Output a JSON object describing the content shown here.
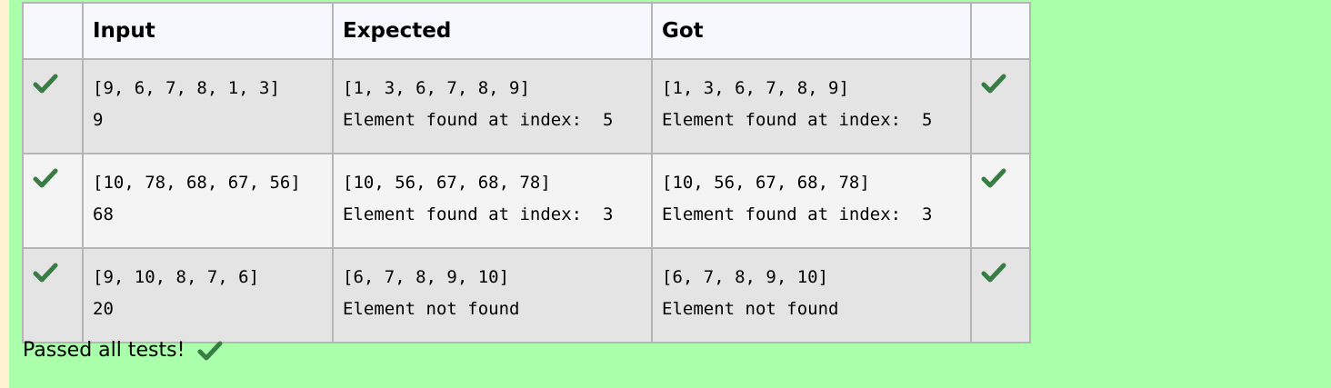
{
  "colors": {
    "page_background": "#aaffaa",
    "left_strip": "#fdf3d2",
    "check_mark": "#3a7d44",
    "header_background": "#f6f8fd",
    "row_odd_background": "#e4e4e4",
    "row_even_background": "#f4f4f4"
  },
  "table": {
    "headers": [
      "",
      "Input",
      "Expected",
      "Got",
      ""
    ],
    "rows": [
      {
        "status_icon": "check-icon",
        "input": [
          "[9, 6, 7, 8, 1, 3]",
          "9"
        ],
        "expected": [
          "[1, 3, 6, 7, 8, 9]",
          "Element found at index:  5"
        ],
        "got": [
          "[1, 3, 6, 7, 8, 9]",
          "Element found at index:  5"
        ],
        "result_icon": "check-icon"
      },
      {
        "status_icon": "check-icon",
        "input": [
          "[10, 78, 68, 67, 56]",
          "68"
        ],
        "expected": [
          "[10, 56, 67, 68, 78]",
          "Element found at index:  3"
        ],
        "got": [
          "[10, 56, 67, 68, 78]",
          "Element found at index:  3"
        ],
        "result_icon": "check-icon"
      },
      {
        "status_icon": "check-icon",
        "input": [
          "[9, 10, 8, 7, 6]",
          "20"
        ],
        "expected": [
          "[6, 7, 8, 9, 10]",
          "Element not found"
        ],
        "got": [
          "[6, 7, 8, 9, 10]",
          "Element not found"
        ],
        "result_icon": "check-icon"
      }
    ]
  },
  "summary": {
    "text": "Passed all tests!",
    "icon": "check-icon"
  }
}
